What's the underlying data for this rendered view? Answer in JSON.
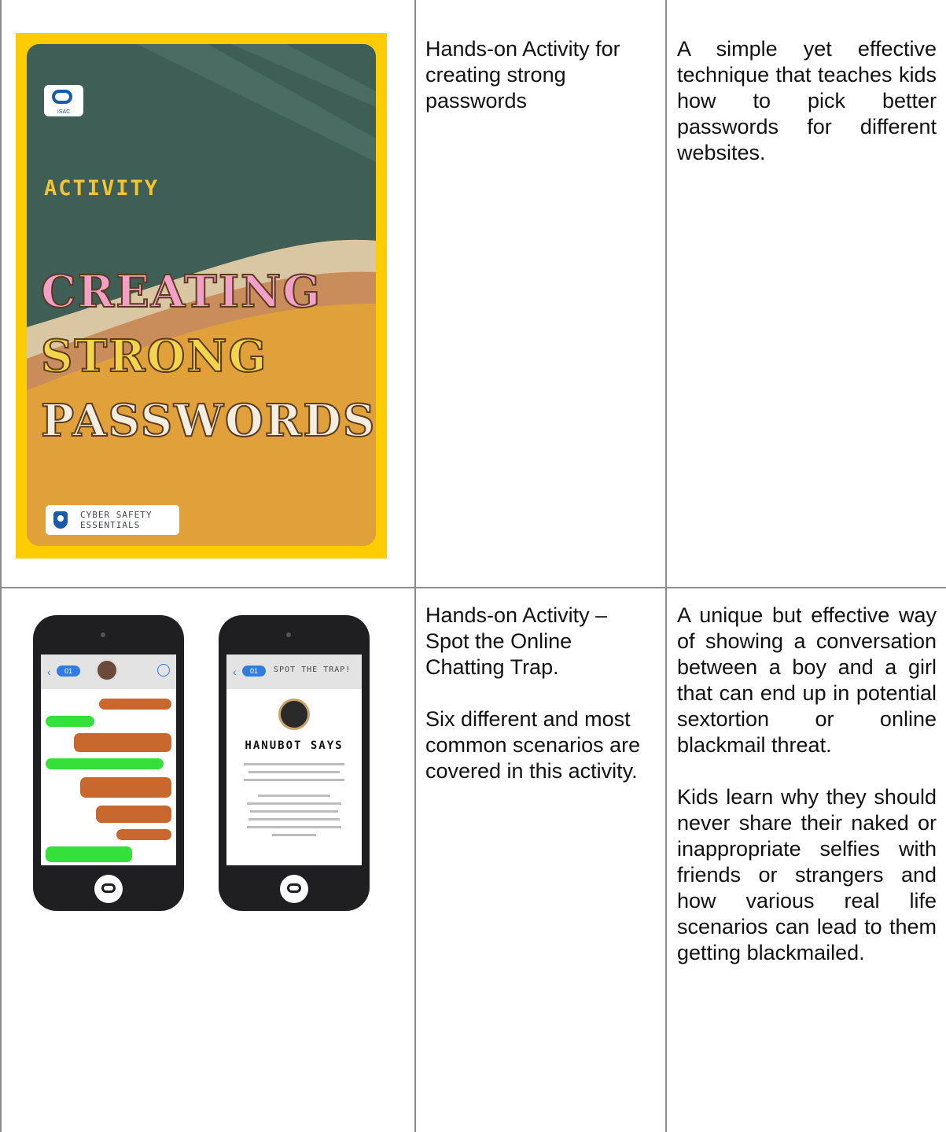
{
  "rows": [
    {
      "title": "Hands-on Activity for creating strong passwords",
      "description": "A simple yet effective technique that teaches kids how to pick better passwords for different websites.",
      "image": {
        "poster_label": "ACTIVITY",
        "poster_words": [
          "CREATING",
          "STRONG",
          "PASSWORDS"
        ],
        "logo_text": "ISAC",
        "badge_text": [
          "CYBER SAFETY",
          "ESSENTIALS"
        ],
        "colors": {
          "frame": "#ffcc00",
          "teal": "#3f5e55",
          "orange": "#e0a03a"
        }
      }
    },
    {
      "title": "Hands-on Activity – Spot the Online Chatting Trap.",
      "title_extra": "Six different and most common scenarios are covered in this activity.",
      "description": "A unique but effective way of showing a conversation between a boy and a girl that can end up in potential sextortion or online blackmail threat.",
      "description_extra": "Kids learn why they should never share their naked or inappropriate selfies with friends or strangers and how various real life scenarios can lead to them getting blackmailed.",
      "image": {
        "phone1_pill": "01",
        "phone2_pill": "01",
        "phone2_title": "SPOT THE TRAP!",
        "phone2_heading": "HANUBOT SAYS"
      }
    }
  ]
}
